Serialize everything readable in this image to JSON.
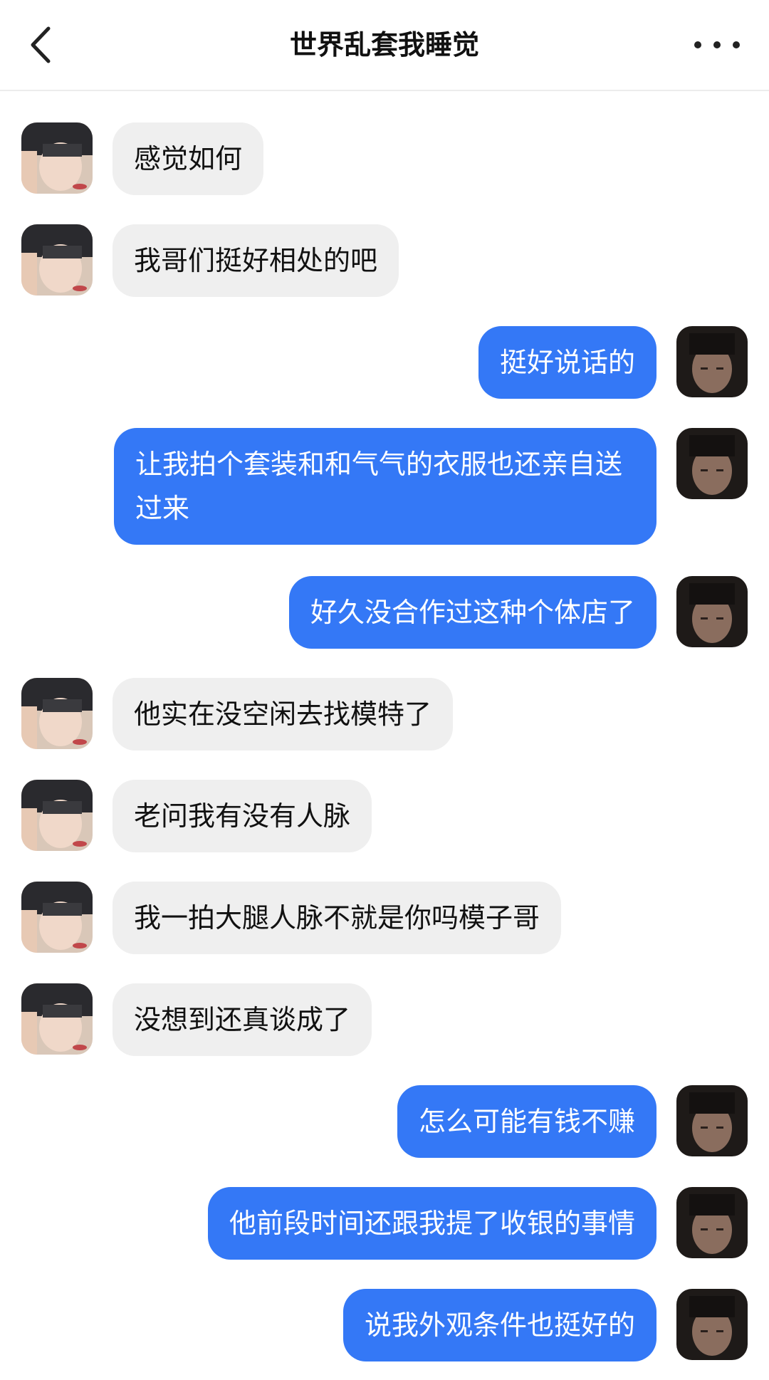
{
  "header": {
    "title": "世界乱套我睡觉",
    "back_icon": "chevron-left-icon",
    "more_icon": "more-dots-icon"
  },
  "colors": {
    "sent_bubble": "#3478f6",
    "received_bubble": "#efefef"
  },
  "messages": [
    {
      "side": "left",
      "text": "感觉如何"
    },
    {
      "side": "left",
      "text": "我哥们挺好相处的吧"
    },
    {
      "side": "right",
      "text": "挺好说话的"
    },
    {
      "side": "right",
      "text": "让我拍个套装和和气气的衣服也还亲自送过来"
    },
    {
      "side": "right",
      "text": "好久没合作过这种个体店了"
    },
    {
      "side": "left",
      "text": "他实在没空闲去找模特了"
    },
    {
      "side": "left",
      "text": "老问我有没有人脉"
    },
    {
      "side": "left",
      "text": "我一拍大腿人脉不就是你吗模子哥"
    },
    {
      "side": "left",
      "text": "没想到还真谈成了"
    },
    {
      "side": "right",
      "text": "怎么可能有钱不赚"
    },
    {
      "side": "right",
      "text": "他前段时间还跟我提了收银的事情"
    },
    {
      "side": "right",
      "text": "说我外观条件也挺好的"
    }
  ]
}
